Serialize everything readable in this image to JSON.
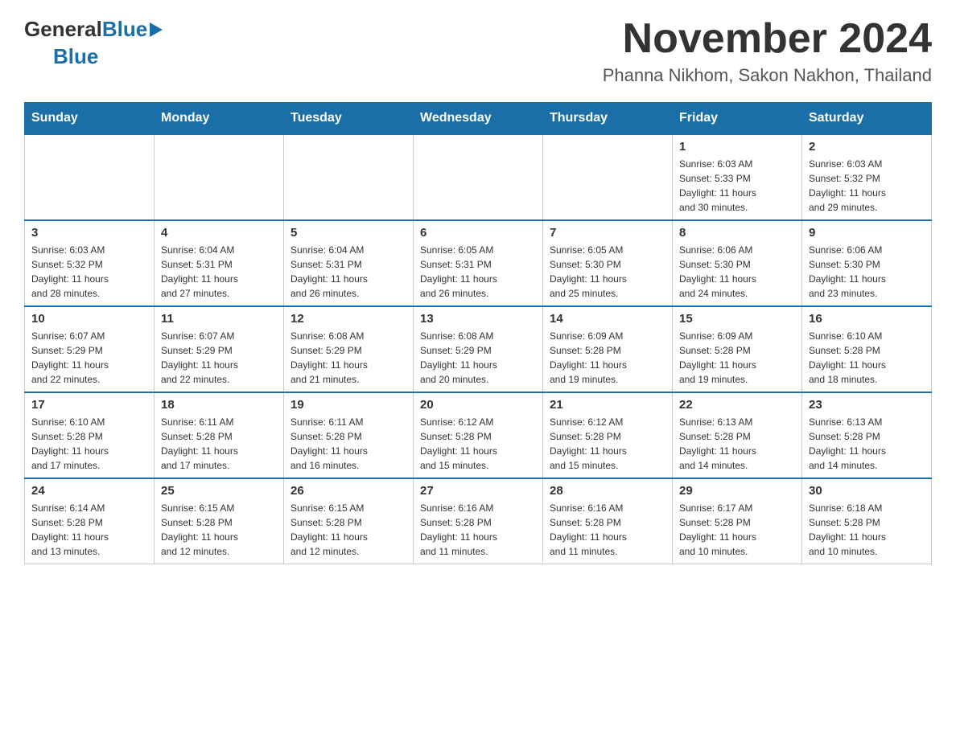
{
  "logo": {
    "general": "General",
    "blue": "Blue",
    "triangle": "▶"
  },
  "header": {
    "month_title": "November 2024",
    "location": "Phanna Nikhom, Sakon Nakhon, Thailand"
  },
  "weekdays": [
    "Sunday",
    "Monday",
    "Tuesday",
    "Wednesday",
    "Thursday",
    "Friday",
    "Saturday"
  ],
  "weeks": [
    [
      {
        "day": "",
        "info": ""
      },
      {
        "day": "",
        "info": ""
      },
      {
        "day": "",
        "info": ""
      },
      {
        "day": "",
        "info": ""
      },
      {
        "day": "",
        "info": ""
      },
      {
        "day": "1",
        "info": "Sunrise: 6:03 AM\nSunset: 5:33 PM\nDaylight: 11 hours\nand 30 minutes."
      },
      {
        "day": "2",
        "info": "Sunrise: 6:03 AM\nSunset: 5:32 PM\nDaylight: 11 hours\nand 29 minutes."
      }
    ],
    [
      {
        "day": "3",
        "info": "Sunrise: 6:03 AM\nSunset: 5:32 PM\nDaylight: 11 hours\nand 28 minutes."
      },
      {
        "day": "4",
        "info": "Sunrise: 6:04 AM\nSunset: 5:31 PM\nDaylight: 11 hours\nand 27 minutes."
      },
      {
        "day": "5",
        "info": "Sunrise: 6:04 AM\nSunset: 5:31 PM\nDaylight: 11 hours\nand 26 minutes."
      },
      {
        "day": "6",
        "info": "Sunrise: 6:05 AM\nSunset: 5:31 PM\nDaylight: 11 hours\nand 26 minutes."
      },
      {
        "day": "7",
        "info": "Sunrise: 6:05 AM\nSunset: 5:30 PM\nDaylight: 11 hours\nand 25 minutes."
      },
      {
        "day": "8",
        "info": "Sunrise: 6:06 AM\nSunset: 5:30 PM\nDaylight: 11 hours\nand 24 minutes."
      },
      {
        "day": "9",
        "info": "Sunrise: 6:06 AM\nSunset: 5:30 PM\nDaylight: 11 hours\nand 23 minutes."
      }
    ],
    [
      {
        "day": "10",
        "info": "Sunrise: 6:07 AM\nSunset: 5:29 PM\nDaylight: 11 hours\nand 22 minutes."
      },
      {
        "day": "11",
        "info": "Sunrise: 6:07 AM\nSunset: 5:29 PM\nDaylight: 11 hours\nand 22 minutes."
      },
      {
        "day": "12",
        "info": "Sunrise: 6:08 AM\nSunset: 5:29 PM\nDaylight: 11 hours\nand 21 minutes."
      },
      {
        "day": "13",
        "info": "Sunrise: 6:08 AM\nSunset: 5:29 PM\nDaylight: 11 hours\nand 20 minutes."
      },
      {
        "day": "14",
        "info": "Sunrise: 6:09 AM\nSunset: 5:28 PM\nDaylight: 11 hours\nand 19 minutes."
      },
      {
        "day": "15",
        "info": "Sunrise: 6:09 AM\nSunset: 5:28 PM\nDaylight: 11 hours\nand 19 minutes."
      },
      {
        "day": "16",
        "info": "Sunrise: 6:10 AM\nSunset: 5:28 PM\nDaylight: 11 hours\nand 18 minutes."
      }
    ],
    [
      {
        "day": "17",
        "info": "Sunrise: 6:10 AM\nSunset: 5:28 PM\nDaylight: 11 hours\nand 17 minutes."
      },
      {
        "day": "18",
        "info": "Sunrise: 6:11 AM\nSunset: 5:28 PM\nDaylight: 11 hours\nand 17 minutes."
      },
      {
        "day": "19",
        "info": "Sunrise: 6:11 AM\nSunset: 5:28 PM\nDaylight: 11 hours\nand 16 minutes."
      },
      {
        "day": "20",
        "info": "Sunrise: 6:12 AM\nSunset: 5:28 PM\nDaylight: 11 hours\nand 15 minutes."
      },
      {
        "day": "21",
        "info": "Sunrise: 6:12 AM\nSunset: 5:28 PM\nDaylight: 11 hours\nand 15 minutes."
      },
      {
        "day": "22",
        "info": "Sunrise: 6:13 AM\nSunset: 5:28 PM\nDaylight: 11 hours\nand 14 minutes."
      },
      {
        "day": "23",
        "info": "Sunrise: 6:13 AM\nSunset: 5:28 PM\nDaylight: 11 hours\nand 14 minutes."
      }
    ],
    [
      {
        "day": "24",
        "info": "Sunrise: 6:14 AM\nSunset: 5:28 PM\nDaylight: 11 hours\nand 13 minutes."
      },
      {
        "day": "25",
        "info": "Sunrise: 6:15 AM\nSunset: 5:28 PM\nDaylight: 11 hours\nand 12 minutes."
      },
      {
        "day": "26",
        "info": "Sunrise: 6:15 AM\nSunset: 5:28 PM\nDaylight: 11 hours\nand 12 minutes."
      },
      {
        "day": "27",
        "info": "Sunrise: 6:16 AM\nSunset: 5:28 PM\nDaylight: 11 hours\nand 11 minutes."
      },
      {
        "day": "28",
        "info": "Sunrise: 6:16 AM\nSunset: 5:28 PM\nDaylight: 11 hours\nand 11 minutes."
      },
      {
        "day": "29",
        "info": "Sunrise: 6:17 AM\nSunset: 5:28 PM\nDaylight: 11 hours\nand 10 minutes."
      },
      {
        "day": "30",
        "info": "Sunrise: 6:18 AM\nSunset: 5:28 PM\nDaylight: 11 hours\nand 10 minutes."
      }
    ]
  ]
}
